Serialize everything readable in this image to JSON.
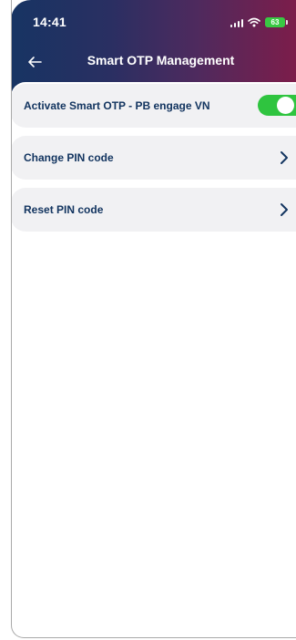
{
  "status_bar": {
    "time": "14:41",
    "battery": "63"
  },
  "header": {
    "title": "Smart OTP Management",
    "back_icon": "arrow-left-icon"
  },
  "settings": {
    "items": [
      {
        "label": "Activate Smart OTP - PB engage VN",
        "control": "toggle",
        "enabled": true
      },
      {
        "label": "Change PIN code",
        "control": "chevron-right-icon"
      },
      {
        "label": "Reset PIN code",
        "control": "chevron-right-icon"
      }
    ]
  },
  "colors": {
    "brand_navy": "#133560",
    "gradient_start": "#173463",
    "gradient_end": "#7c1d4a",
    "toggle_on": "#2fc43f",
    "card_background": "#f1f1f3",
    "battery": "#39c843"
  }
}
